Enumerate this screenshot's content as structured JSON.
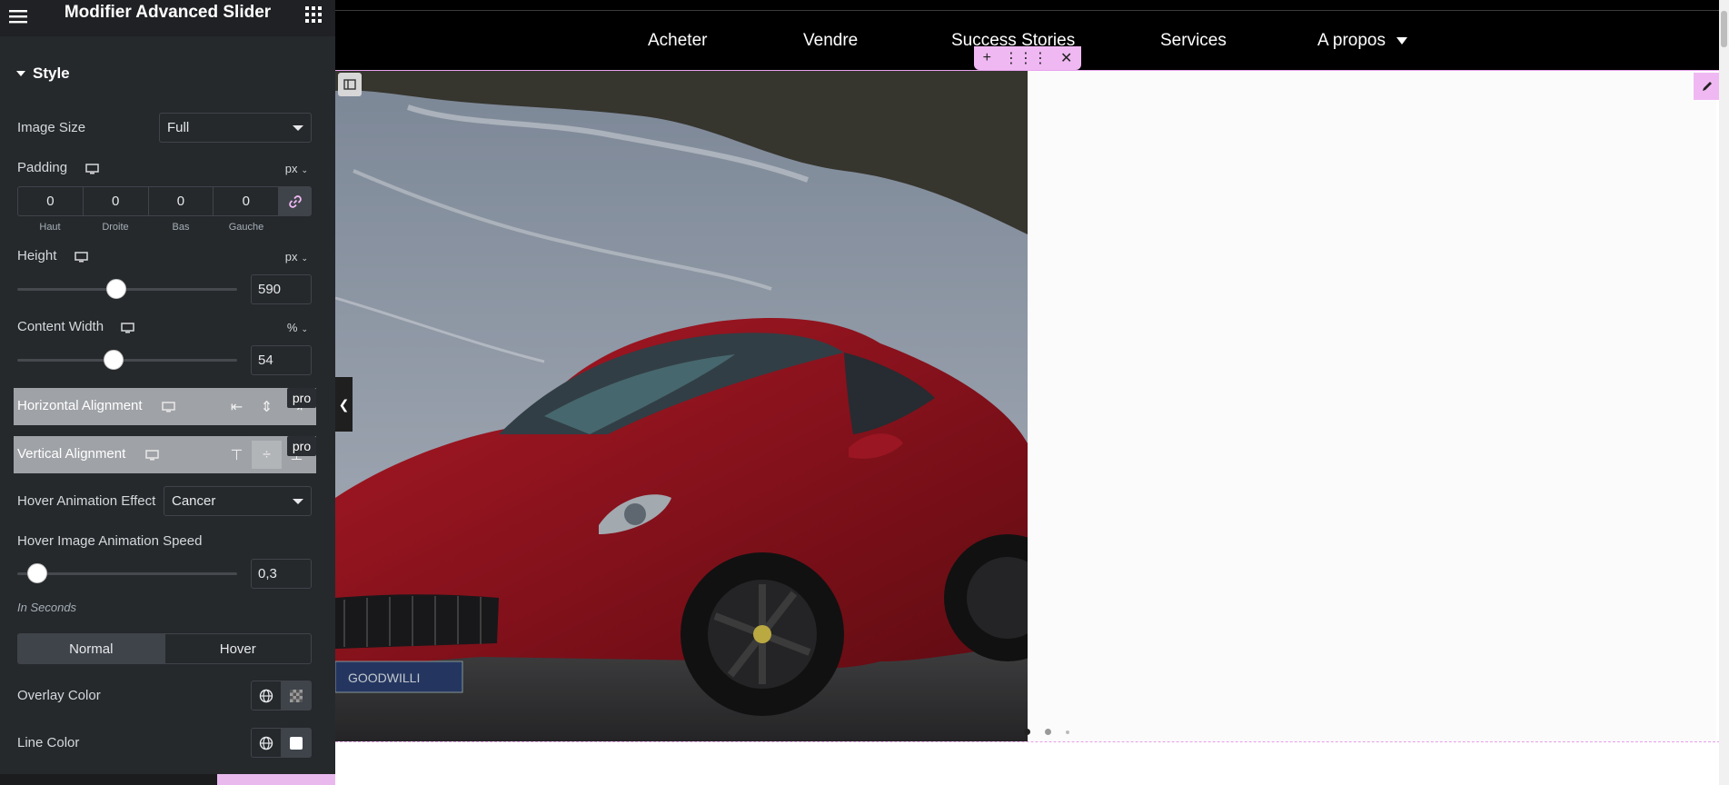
{
  "panel": {
    "title": "Modifier Advanced Slider",
    "section_title": "Style",
    "image_size": {
      "label": "Image Size",
      "value": "Full"
    },
    "padding": {
      "label": "Padding",
      "unit": "px",
      "values": [
        "0",
        "0",
        "0",
        "0"
      ],
      "sides": [
        "Haut",
        "Droite",
        "Bas",
        "Gauche"
      ]
    },
    "height": {
      "label": "Height",
      "unit": "px",
      "value": "590",
      "slider_fraction": 0.45
    },
    "content_width": {
      "label": "Content Width",
      "unit": "%",
      "value": "54",
      "slider_fraction": 0.44
    },
    "horizontal_alignment": {
      "label": "Horizontal Alignment",
      "pro_label": "pro"
    },
    "vertical_alignment": {
      "label": "Vertical Alignment",
      "pro_label": "pro"
    },
    "hover_effect": {
      "label": "Hover Animation Effect",
      "value": "Cancer"
    },
    "hover_speed": {
      "label": "Hover Image Animation Speed",
      "value": "0,3",
      "slider_fraction": 0.09,
      "note": "In Seconds"
    },
    "tabs": [
      "Normal",
      "Hover"
    ],
    "overlay_color": {
      "label": "Overlay Color"
    },
    "line_color": {
      "label": "Line Color"
    }
  },
  "nav": {
    "items": [
      "Acheter",
      "Vendre",
      "Success Stories",
      "Services",
      "A propos"
    ]
  },
  "slide": {
    "plate_text": "GOODWILLI"
  },
  "colors": {
    "panel_bg": "#26292c",
    "accent_pink": "#f0b8f3",
    "car_red": "#a01522"
  },
  "icons": [
    "hamburger-icon",
    "apps-grid-icon",
    "monitor-icon",
    "link-icon",
    "globe-icon",
    "checker-icon",
    "plus-icon",
    "drag-icon",
    "close-icon",
    "pencil-icon",
    "columns-icon",
    "chevron-left-icon"
  ]
}
